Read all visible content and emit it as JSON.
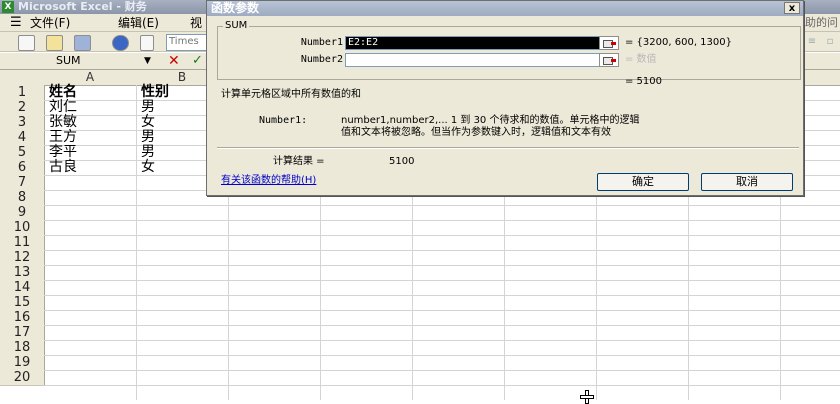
{
  "window": {
    "title": "Microsoft Excel - 财务"
  },
  "menu": {
    "items": [
      "文件(F)",
      "编辑(E)",
      "视"
    ],
    "right_text": "助的问"
  },
  "toolbar": {
    "font_box": "Times"
  },
  "formula_bar": {
    "name_box": "SUM"
  },
  "sheet": {
    "columns": [
      "A",
      "B"
    ],
    "rows": [
      "1",
      "2",
      "3",
      "4",
      "5",
      "6",
      "7",
      "8",
      "9",
      "10",
      "11",
      "12",
      "13",
      "14",
      "15",
      "16",
      "17",
      "18",
      "19",
      "20"
    ],
    "cells": [
      [
        "姓名",
        "性别"
      ],
      [
        "刘仁",
        "男"
      ],
      [
        "张敏",
        "女"
      ],
      [
        "王方",
        "男"
      ],
      [
        "李平",
        "男"
      ],
      [
        "古良",
        "女"
      ]
    ]
  },
  "dialog": {
    "title": "函数参数",
    "close_label": "x",
    "group_label": "SUM",
    "args": [
      {
        "label": "Number1",
        "value": "E2:E2",
        "result": "= {3200, 600, 1300}"
      },
      {
        "label": "Number2",
        "value": "",
        "result": "= 数值"
      }
    ],
    "total_result": "= 5100",
    "description": "计算单元格区域中所有数值的和",
    "arg_help_label": "Number1:",
    "arg_help_line1": "number1,number2,... 1 到 30 个待求和的数值。单元格中的逻辑",
    "arg_help_line2": "值和文本将被忽略。但当作为参数键入时，逻辑值和文本有效",
    "calc_label": "计算结果 =",
    "calc_value": "5100",
    "help_link": "有关该函数的帮助(H)",
    "ok_label": "确定",
    "cancel_label": "取消"
  }
}
